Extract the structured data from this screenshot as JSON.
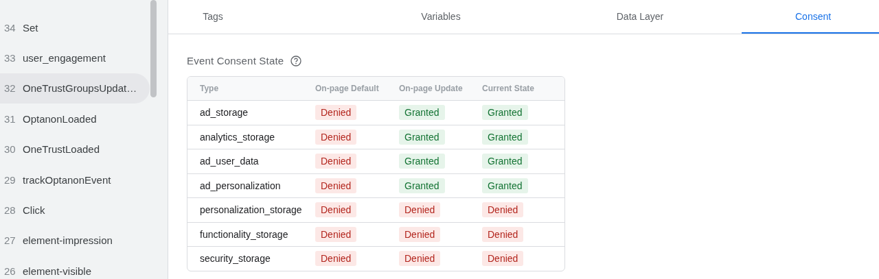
{
  "sidebar": {
    "items": [
      {
        "number": "34",
        "name": "Set",
        "selected": false
      },
      {
        "number": "33",
        "name": "user_engagement",
        "selected": false
      },
      {
        "number": "32",
        "name": "OneTrustGroupsUpdat…",
        "selected": true
      },
      {
        "number": "31",
        "name": "OptanonLoaded",
        "selected": false
      },
      {
        "number": "30",
        "name": "OneTrustLoaded",
        "selected": false
      },
      {
        "number": "29",
        "name": "trackOptanonEvent",
        "selected": false
      },
      {
        "number": "28",
        "name": "Click",
        "selected": false
      },
      {
        "number": "27",
        "name": "element-impression",
        "selected": false
      },
      {
        "number": "26",
        "name": "element-visible",
        "selected": false
      }
    ]
  },
  "tabs": [
    {
      "label": "Tags",
      "selected": false
    },
    {
      "label": "Variables",
      "selected": false
    },
    {
      "label": "Data Layer",
      "selected": false
    },
    {
      "label": "Consent",
      "selected": true
    }
  ],
  "section": {
    "title": "Event Consent State"
  },
  "table": {
    "columns": [
      "Type",
      "On-page Default",
      "On-page Update",
      "Current State"
    ],
    "rows": [
      {
        "type": "ad_storage",
        "states": [
          {
            "text": "Denied",
            "granted": false
          },
          {
            "text": "Granted",
            "granted": true
          },
          {
            "text": "Granted",
            "granted": true
          }
        ]
      },
      {
        "type": "analytics_storage",
        "states": [
          {
            "text": "Denied",
            "granted": false
          },
          {
            "text": "Granted",
            "granted": true
          },
          {
            "text": "Granted",
            "granted": true
          }
        ]
      },
      {
        "type": "ad_user_data",
        "states": [
          {
            "text": "Denied",
            "granted": false
          },
          {
            "text": "Granted",
            "granted": true
          },
          {
            "text": "Granted",
            "granted": true
          }
        ]
      },
      {
        "type": "ad_personalization",
        "states": [
          {
            "text": "Denied",
            "granted": false
          },
          {
            "text": "Granted",
            "granted": true
          },
          {
            "text": "Granted",
            "granted": true
          }
        ]
      },
      {
        "type": "personalization_storage",
        "states": [
          {
            "text": "Denied",
            "granted": false
          },
          {
            "text": "Denied",
            "granted": false
          },
          {
            "text": "Denied",
            "granted": false
          }
        ]
      },
      {
        "type": "functionality_storage",
        "states": [
          {
            "text": "Denied",
            "granted": false
          },
          {
            "text": "Denied",
            "granted": false
          },
          {
            "text": "Denied",
            "granted": false
          }
        ]
      },
      {
        "type": "security_storage",
        "states": [
          {
            "text": "Denied",
            "granted": false
          },
          {
            "text": "Denied",
            "granted": false
          },
          {
            "text": "Denied",
            "granted": false
          }
        ]
      }
    ]
  }
}
